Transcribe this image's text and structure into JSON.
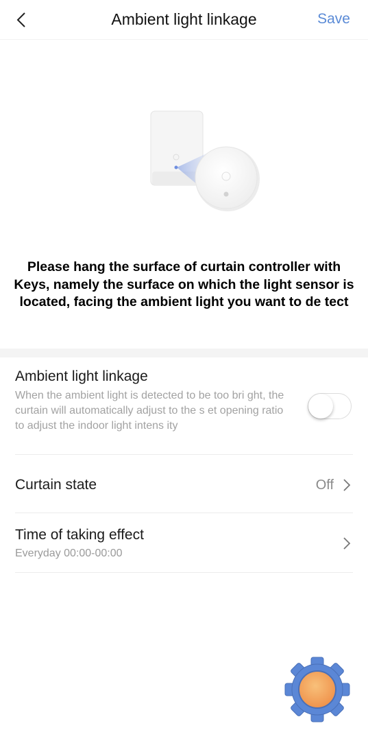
{
  "header": {
    "title": "Ambient light linkage",
    "save_label": "Save",
    "back_icon": "chevron-left-icon"
  },
  "illustration": {
    "description_icon": "curtain-controller-light-sensor"
  },
  "instructions": {
    "text": "Please hang the surface of curtain controller with Keys, namely the surface on which the light sensor is located, facing the ambient light you want to de tect"
  },
  "settings": {
    "linkage": {
      "title": "Ambient light linkage",
      "description": "When the ambient light is detected to be too bri ght, the curtain will automatically adjust to the s et opening ratio to adjust the indoor light intens ity",
      "enabled": false
    },
    "curtain_state": {
      "title": "Curtain state",
      "value": "Off"
    },
    "time_effect": {
      "title": "Time of taking effect",
      "value": "Everyday 00:00-00:00"
    }
  },
  "colors": {
    "accent": "#5a8ad6",
    "fab_gear": "#5b87d6",
    "fab_center": "#f4a15c"
  }
}
